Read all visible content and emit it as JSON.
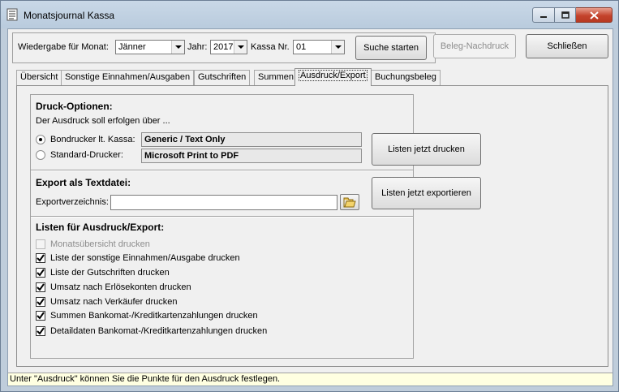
{
  "window": {
    "title": "Monatsjournal Kassa"
  },
  "toolbar": {
    "month_label": "Wiedergabe für Monat:",
    "month_value": "Jänner",
    "year_label": "Jahr:",
    "year_value": "2017",
    "register_label": "Kassa Nr.",
    "register_value": "01",
    "search_button": "Suche starten",
    "receipt_reprint_button": "Beleg-Nachdruck",
    "close_button": "Schließen"
  },
  "tabs": [
    {
      "label": "Übersicht"
    },
    {
      "label": "Sonstige Einnahmen/Ausgaben"
    },
    {
      "label": "Gutschriften"
    },
    {
      "label": "Summen"
    },
    {
      "label": "Ausdruck/Export",
      "active": true
    },
    {
      "label": "Buchungsbeleg"
    }
  ],
  "print_options": {
    "heading": "Druck-Optionen:",
    "description": "Der Ausdruck soll erfolgen über ...",
    "receipt_printer_label": "Bondrucker lt. Kassa:",
    "receipt_printer_value": "Generic / Text Only",
    "standard_printer_label": "Standard-Drucker:",
    "standard_printer_value": "Microsoft Print to PDF",
    "selected": "receipt_printer",
    "print_button": "Listen jetzt drucken"
  },
  "export": {
    "heading": "Export als Textdatei:",
    "directory_label": "Exportverzeichnis:",
    "directory_value": "",
    "export_button": "Listen jetzt exportieren"
  },
  "lists": {
    "heading": "Listen für Ausdruck/Export:",
    "items": [
      {
        "label": "Monatsübersicht drucken",
        "checked": false,
        "enabled": false
      },
      {
        "label": "Liste der sonstige Einnahmen/Ausgabe drucken",
        "checked": true,
        "enabled": true
      },
      {
        "label": "Liste der Gutschriften drucken",
        "checked": true,
        "enabled": true
      },
      {
        "label": "Umsatz nach Erlösekonten drucken",
        "checked": true,
        "enabled": true
      },
      {
        "label": "Umsatz nach Verkäufer drucken",
        "checked": true,
        "enabled": true
      },
      {
        "label": "Summen Bankomat-/Kreditkartenzahlungen drucken",
        "checked": true,
        "enabled": true
      },
      {
        "label": "Detaildaten Bankomat-/Kreditkartenzahlungen drucken",
        "checked": true,
        "enabled": true
      }
    ]
  },
  "status": {
    "text": "Unter \"Ausdruck\" können Sie die Punkte für den Ausdruck festlegen."
  }
}
